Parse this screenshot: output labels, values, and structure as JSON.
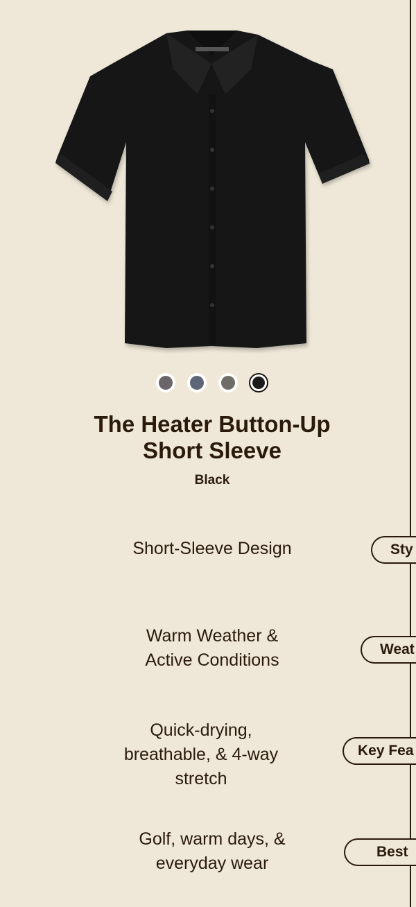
{
  "product": {
    "title_line1": "The Heater Button-Up",
    "title_line2": "Short Sleeve",
    "color_name": "Black",
    "image_icon": "black-short-sleeve-shirt"
  },
  "swatches": [
    {
      "name": "charcoal-purple",
      "color": "#6b6468",
      "selected": false
    },
    {
      "name": "slate-blue",
      "color": "#5d6577",
      "selected": false
    },
    {
      "name": "olive-grey",
      "color": "#6e6e66",
      "selected": false
    },
    {
      "name": "black",
      "color": "#1c1c1a",
      "selected": true
    }
  ],
  "features": [
    {
      "lines": [
        "Short-Sleeve Design"
      ],
      "tab_label": "Sty"
    },
    {
      "lines": [
        "Warm Weather &",
        "Active Conditions"
      ],
      "tab_label": "Weat"
    },
    {
      "lines": [
        "Quick-drying,",
        "breathable, & 4-way",
        "stretch"
      ],
      "tab_label": "Key Fea"
    },
    {
      "lines": [
        "Golf, warm days, &",
        "everyday wear"
      ],
      "tab_label": "Best"
    }
  ]
}
